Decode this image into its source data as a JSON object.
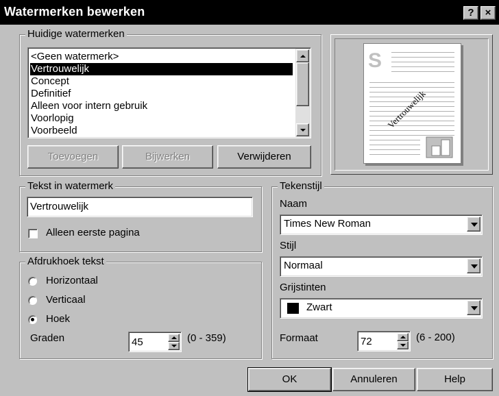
{
  "window": {
    "title": "Watermerken bewerken",
    "help_button": "?",
    "close_button": "×"
  },
  "current_watermarks": {
    "legend": "Huidige watermerken",
    "items": [
      "<Geen watermerk>",
      "Vertrouwelijk",
      "Concept",
      "Definitief",
      "Alleen voor intern gebruik",
      "Voorlopig",
      "Voorbeeld"
    ],
    "selected_index": 1,
    "add_label": "Toevoegen",
    "update_label": "Bijwerken",
    "delete_label": "Verwijderen"
  },
  "preview": {
    "watermark_text": "Vertrouwelijk",
    "logo_letter": "S"
  },
  "watermark_text": {
    "legend": "Tekst in watermerk",
    "value": "Vertrouwelijk",
    "first_page_only_label": "Alleen eerste pagina",
    "first_page_only_checked": false
  },
  "print_angle": {
    "legend": "Afdrukhoek tekst",
    "horizontal_label": "Horizontaal",
    "vertical_label": "Verticaal",
    "angle_label": "Hoek",
    "selected": "angle",
    "degrees_label": "Graden",
    "degrees_value": "45",
    "degrees_range": "(0 - 359)"
  },
  "font_style": {
    "legend": "Tekenstijl",
    "name_label": "Naam",
    "name_value": "Times New Roman",
    "style_label": "Stijl",
    "style_value": "Normaal",
    "gray_label": "Grijstinten",
    "gray_value": "Zwart",
    "gray_swatch": "#000000",
    "size_label": "Formaat",
    "size_value": "72",
    "size_range": "(6 - 200)"
  },
  "footer": {
    "ok_label": "OK",
    "cancel_label": "Annuleren",
    "help_label": "Help"
  }
}
